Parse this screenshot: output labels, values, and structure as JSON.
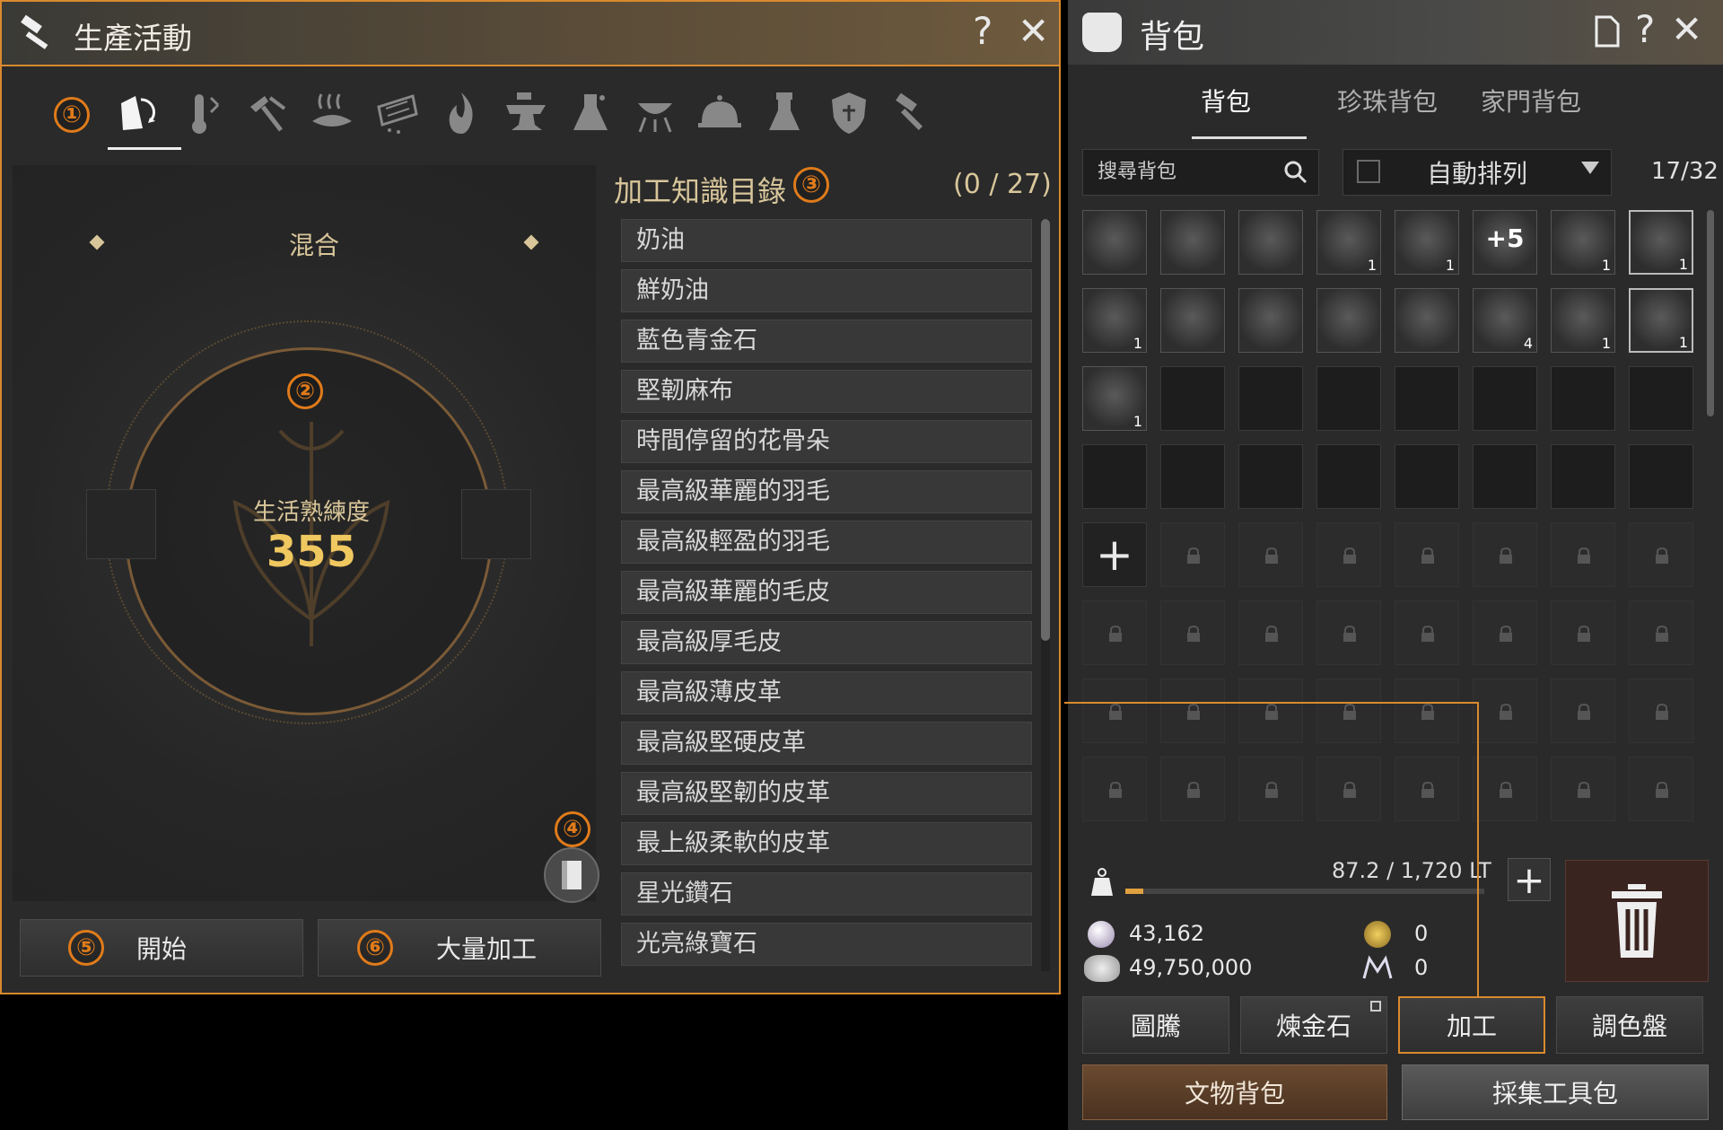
{
  "production": {
    "title": "生產活動",
    "help": "?",
    "close": "✕",
    "tabs": [
      {
        "icon": "tools-icon"
      },
      {
        "icon": "heat-icon"
      },
      {
        "icon": "chop-icon"
      },
      {
        "icon": "dry-icon"
      },
      {
        "icon": "filter-icon"
      },
      {
        "icon": "fire-icon"
      },
      {
        "icon": "anvil-icon"
      },
      {
        "icon": "flask-icon"
      },
      {
        "icon": "grill-icon"
      },
      {
        "icon": "dish-icon"
      },
      {
        "icon": "alchemy-icon"
      },
      {
        "icon": "shield-icon"
      },
      {
        "icon": "hammer-icon"
      }
    ],
    "mode": "混合",
    "skill_label": "生活熟練度",
    "skill_value": "355",
    "start_button": "開始",
    "mass_button": "大量加工",
    "knowledge_title": "加工知識目錄",
    "knowledge_count": "(0 / 27)",
    "knowledge_items": [
      "奶油",
      "鮮奶油",
      "藍色青金石",
      "堅韌麻布",
      "時間停留的花骨朵",
      "最高級華麗的羽毛",
      "最高級輕盈的羽毛",
      "最高級華麗的毛皮",
      "最高級厚毛皮",
      "最高級薄皮革",
      "最高級堅硬皮革",
      "最高級堅韌的皮革",
      "最上級柔軟的皮革",
      "星光鑽石",
      "光亮綠寶石"
    ]
  },
  "markers": [
    "①",
    "②",
    "③",
    "④",
    "⑤",
    "⑥"
  ],
  "inventory": {
    "title": "背包",
    "help": "?",
    "close": "✕",
    "tabs": [
      "背包",
      "珍珠背包",
      "家門背包"
    ],
    "search_placeholder": "搜尋背包",
    "sort_label": "自動排列",
    "slot_count": "17/32",
    "items": [
      {
        "type": "weapon",
        "count": ""
      },
      {
        "type": "weapon",
        "count": ""
      },
      {
        "type": "weapon",
        "count": ""
      },
      {
        "type": "ore",
        "count": "1"
      },
      {
        "type": "coin",
        "count": "1"
      },
      {
        "type": "enhance",
        "label": "+5",
        "count": ""
      },
      {
        "type": "potion",
        "count": "1"
      },
      {
        "type": "emblem",
        "count": "1"
      },
      {
        "type": "food",
        "count": "1"
      },
      {
        "type": "weapon",
        "count": ""
      },
      {
        "type": "weapon",
        "count": ""
      },
      {
        "type": "weapon",
        "count": ""
      },
      {
        "type": "weapon",
        "count": ""
      },
      {
        "type": "stone",
        "count": "4"
      },
      {
        "type": "hide",
        "count": "1"
      },
      {
        "type": "potion",
        "count": "1"
      },
      {
        "type": "food",
        "count": "1"
      }
    ],
    "weight": "87.2 / 1,720 LT",
    "weight_fraction": 0.05,
    "silver": "43,162",
    "pearls": "49,750,000",
    "mileage": "0",
    "loyalty": "0",
    "buttons": [
      "圖騰",
      "煉金石",
      "加工",
      "調色盤"
    ],
    "bottom_buttons": [
      "文物背包",
      "採集工具包"
    ]
  }
}
